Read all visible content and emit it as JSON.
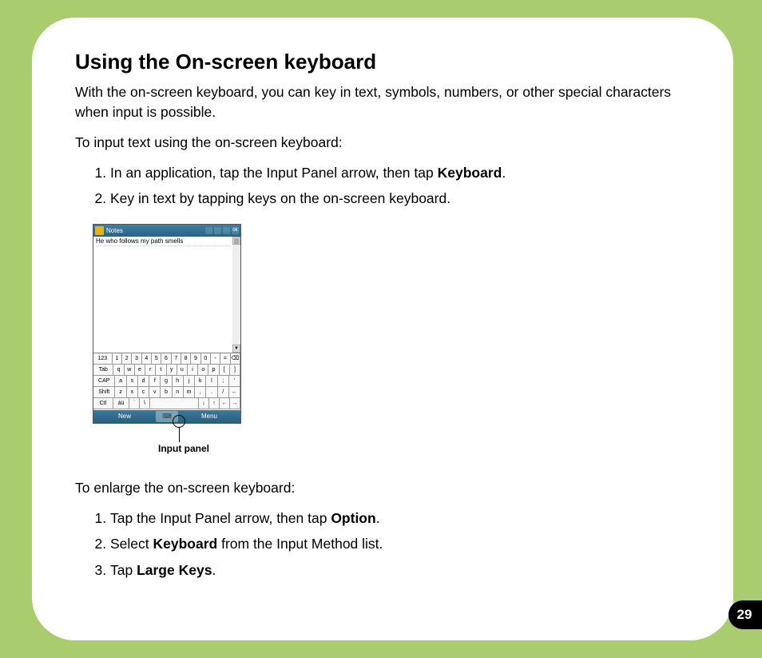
{
  "heading": "Using the On-screen keyboard",
  "intro": "With the on-screen keyboard, you can key in text, symbols, numbers, or other special characters when input is possible.",
  "lead1": "To input text using the on-screen keyboard:",
  "steps1": [
    {
      "pre": "In an application, tap the Input Panel arrow, then tap ",
      "bold": "Keyboard",
      "post": "."
    },
    {
      "pre": "Key in text by tapping keys on the on-screen keyboard.",
      "bold": "",
      "post": ""
    }
  ],
  "device": {
    "title": "Notes",
    "ok": "ok",
    "note_text": "He who follows my path smells",
    "bottom_left": "New",
    "bottom_right": "Menu",
    "center_icon": "⌨",
    "keyboard_rows": [
      [
        "123",
        "1",
        "2",
        "3",
        "4",
        "5",
        "6",
        "7",
        "8",
        "9",
        "0",
        "-",
        "=",
        "⌫"
      ],
      [
        "Tab",
        "q",
        "w",
        "e",
        "r",
        "t",
        "y",
        "u",
        "i",
        "o",
        "p",
        "[",
        "]"
      ],
      [
        "CAP",
        "a",
        "s",
        "d",
        "f",
        "g",
        "h",
        "j",
        "k",
        "l",
        ";",
        "'"
      ],
      [
        "Shift",
        "z",
        "x",
        "c",
        "v",
        "b",
        "n",
        "m",
        ",",
        ".",
        "/",
        "←"
      ],
      [
        "Ctl",
        "áü",
        "`",
        "\\",
        " ",
        "↓",
        "↑",
        "←",
        "→"
      ]
    ]
  },
  "callout_label": "Input panel",
  "lead2": "To enlarge the on-screen keyboard:",
  "steps2": [
    {
      "pre": "Tap the Input Panel arrow, then tap ",
      "bold": "Option",
      "post": "."
    },
    {
      "pre": "Select ",
      "bold": "Keyboard",
      "post": " from the Input Method list."
    },
    {
      "pre": "Tap ",
      "bold": "Large Keys",
      "post": "."
    }
  ],
  "page_number": "29"
}
